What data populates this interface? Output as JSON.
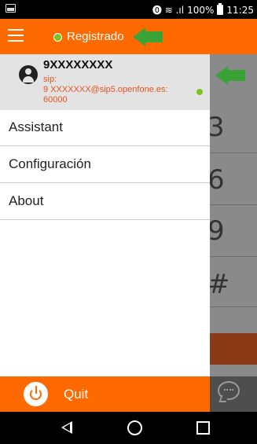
{
  "status_bar": {
    "icons": "⓿ ≋ .ıl",
    "battery": "100%",
    "time": "11:25"
  },
  "header": {
    "status_label": "Registrado",
    "status_color": "#7cc521",
    "accent_color": "#ff6a00"
  },
  "account": {
    "name": "9XXXXXXXX",
    "sip_address": "sip:\n9 XXXXXXX@sip5.openfone.es:\n60000"
  },
  "menu": {
    "items": [
      {
        "label": "Assistant"
      },
      {
        "label": "Configuración"
      },
      {
        "label": "About"
      }
    ]
  },
  "background_keypad": {
    "keys": [
      "3",
      "6",
      "9",
      "#"
    ]
  },
  "quit": {
    "label": "Quit"
  },
  "icons": {
    "menu": "hamburger-icon",
    "avatar": "user-icon",
    "power": "power-icon",
    "chat": "chat-bubble-icon",
    "back": "back-icon",
    "home": "home-icon",
    "recent": "recent-apps-icon"
  }
}
